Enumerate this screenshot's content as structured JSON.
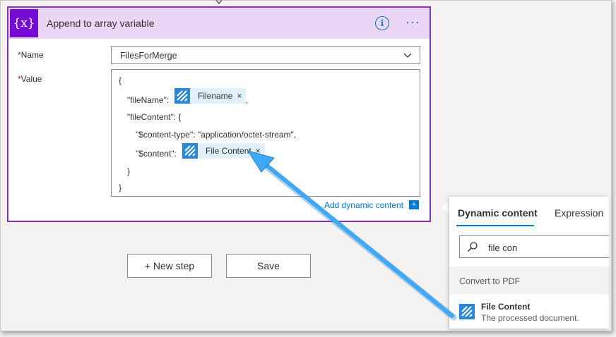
{
  "action": {
    "icon_text": "{x}",
    "title": "Append to array variable",
    "info_icon": "ⓘ",
    "more_icon": "···",
    "name_label": "Name",
    "name_value": "FilesForMerge",
    "value_label": "Value",
    "required_mark": "*",
    "code": {
      "open_brace": "{",
      "filename_key": "\"fileName\":",
      "filename_token": "Filename",
      "comma": ",",
      "filecontent_key": "\"fileContent\": {",
      "content_type_line": "\"$content-type\": \"application/octet-stream\",",
      "content_key": "\"$content\":",
      "content_token": "File Content",
      "inner_close": "}",
      "outer_close": "}"
    },
    "token_close": "×",
    "add_dynamic_content": "Add dynamic content",
    "add_dynamic_icon": "+"
  },
  "buttons": {
    "new_step": "+ New step",
    "save": "Save"
  },
  "panel": {
    "tab_dynamic": "Dynamic content",
    "tab_expression": "Expression",
    "search_value": "file con",
    "group_label": "Convert to PDF",
    "item_title": "File Content",
    "item_desc": "The processed document."
  },
  "colors": {
    "accent": "#0078d4",
    "variable_purple": "#770bd6",
    "card_border": "#8531c7",
    "header_bg": "#ecd6f5",
    "token_icon": "#2b88d8",
    "arrow": "#3fa9f5"
  }
}
